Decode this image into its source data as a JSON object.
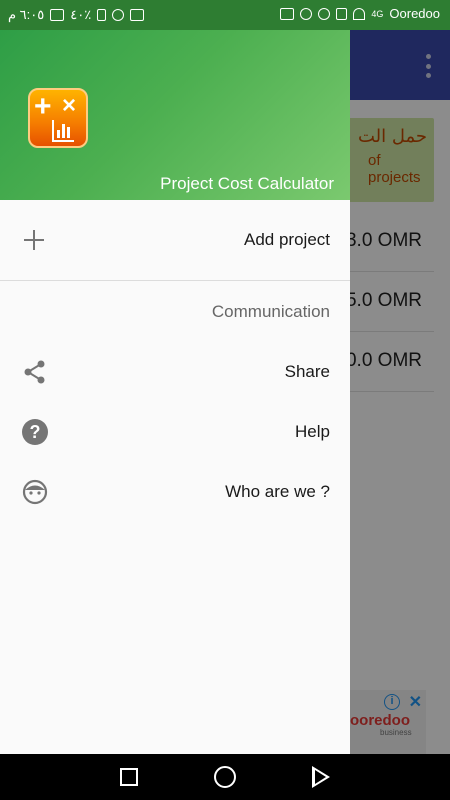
{
  "status_bar": {
    "time": "٦:٠٥ م",
    "battery": "٤٠٪",
    "carrier": "Ooredoo",
    "network": "4G"
  },
  "background": {
    "banner_arabic": "حمل الت",
    "banner_english": "of projects",
    "amounts": [
      "3.0 OMR",
      "5.0 OMR",
      "0.0 OMR"
    ],
    "ad_brand": "ooredoo",
    "ad_sub": "business"
  },
  "drawer": {
    "app_title": "Project Cost Calculator",
    "add_project_label": "Add project",
    "section_header": "Communication",
    "items": [
      {
        "label": "Share",
        "icon": "share-icon"
      },
      {
        "label": "Help",
        "icon": "help-icon"
      },
      {
        "label": "Who are we ?",
        "icon": "face-icon"
      }
    ]
  },
  "colors": {
    "header_green": "#4caf50",
    "toolbar_indigo": "#3949ab",
    "icon_grey": "#757575"
  }
}
